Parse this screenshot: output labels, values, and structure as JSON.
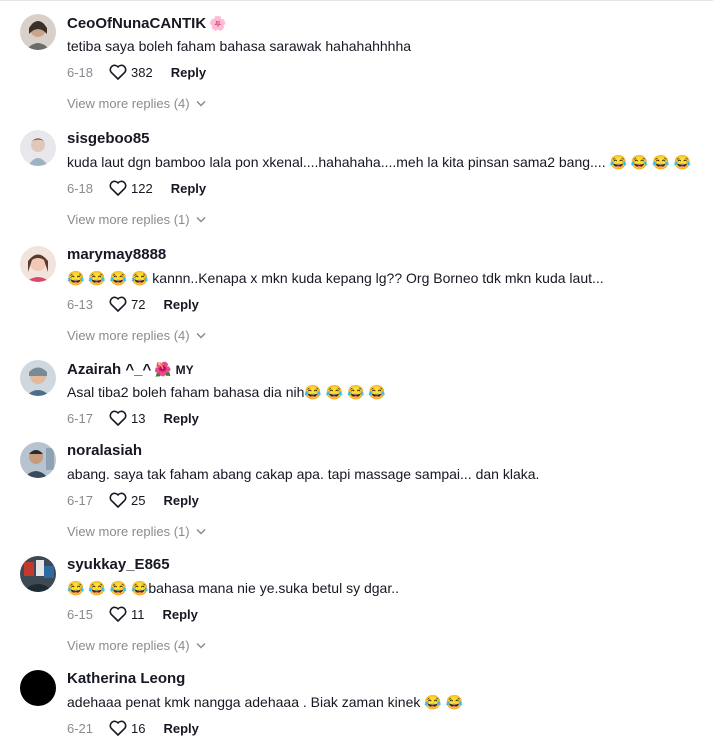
{
  "comments": [
    {
      "username": "CeoOfNunaCANTIK",
      "badge": "🌸",
      "country": "",
      "text": "tetiba saya boleh faham bahasa sarawak hahahahhhha",
      "date": "6-18",
      "likes": "382",
      "reply_label": "Reply",
      "view_more": "View more replies (4)"
    },
    {
      "username": "sisgeboo85",
      "badge": "",
      "country": "",
      "text": "kuda laut dgn bamboo lala pon xkenal....hahahaha....meh la kita pinsan sama2 bang.... 😂 😂 😂 😂",
      "date": "6-18",
      "likes": "122",
      "reply_label": "Reply",
      "view_more": "View more replies (1)"
    },
    {
      "username": "marymay8888",
      "badge": "",
      "country": "",
      "text": "😂 😂 😂 😂  kannn..Kenapa x mkn kuda kepang lg?? Org Borneo tdk mkn kuda laut...",
      "date": "6-13",
      "likes": "72",
      "reply_label": "Reply",
      "view_more": "View more replies (4)"
    },
    {
      "username": "Azairah ^_^",
      "badge": "🌺",
      "country": "MY",
      "text": "Asal tiba2 boleh faham bahasa dia nih😂 😂 😂 😂",
      "date": "6-17",
      "likes": "13",
      "reply_label": "Reply",
      "view_more": ""
    },
    {
      "username": "noralasiah",
      "badge": "",
      "country": "",
      "text": "abang. saya tak faham abang cakap apa. tapi massage sampai... dan klaka.",
      "date": "6-17",
      "likes": "25",
      "reply_label": "Reply",
      "view_more": "View more replies (1)"
    },
    {
      "username": "syukkay_E865",
      "badge": "",
      "country": "",
      "text": "😂 😂 😂 😂bahasa mana nie ye.suka betul sy dgar..",
      "date": "6-15",
      "likes": "11",
      "reply_label": "Reply",
      "view_more": "View more replies (4)"
    },
    {
      "username": "Katherina Leong",
      "badge": "",
      "country": "",
      "text": "adehaaa penat kmk nangga adehaaa . Biak zaman kinek 😂 😂",
      "date": "6-21",
      "likes": "16",
      "reply_label": "Reply",
      "view_more": ""
    }
  ]
}
